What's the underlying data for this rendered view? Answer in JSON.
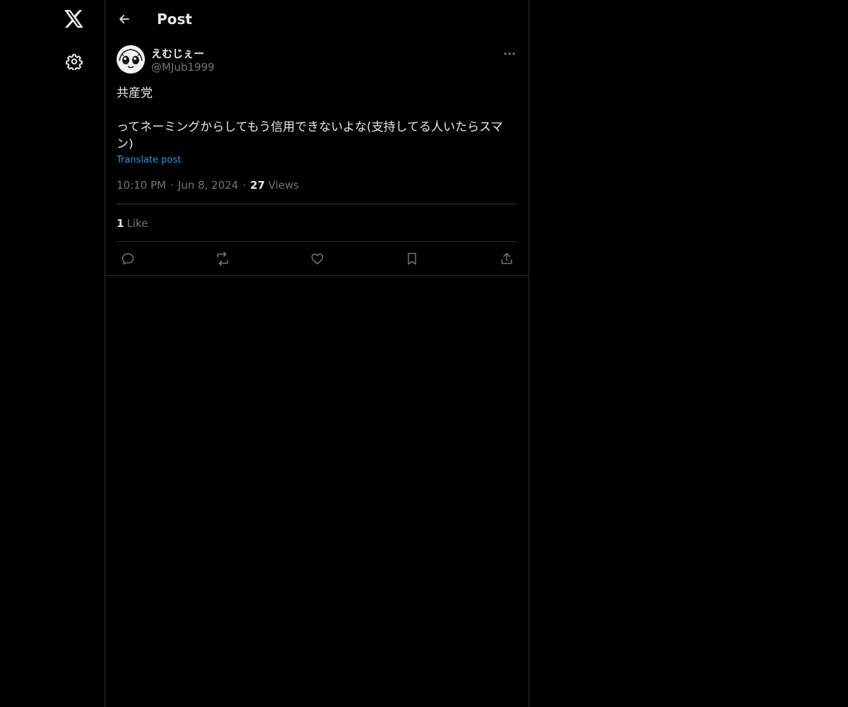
{
  "header": {
    "title": "Post"
  },
  "post": {
    "author": {
      "display_name": "えむじぇー",
      "handle": "@MJub1999"
    },
    "text_line1": "共産党",
    "text_line2": "ってネーミングからしてもう信用できないよな(支持してる人いたらスマン)",
    "translate_label": "Translate post",
    "time": "10:10 PM",
    "date": "Jun 8, 2024",
    "views_count": "27",
    "views_label": "Views",
    "likes_count": "1",
    "likes_label": "Like"
  },
  "icons": {
    "logo": "x-logo-icon",
    "settings": "gear-icon",
    "back": "arrow-left-icon",
    "more": "more-dots-icon",
    "reply": "reply-icon",
    "repost": "repost-icon",
    "like": "heart-icon",
    "bookmark": "bookmark-icon",
    "share": "share-icon"
  },
  "colors": {
    "background": "#000000",
    "text": "#e7e9ea",
    "secondary_text": "#71767b",
    "link": "#1d9bf0",
    "divider": "#2f3336"
  }
}
